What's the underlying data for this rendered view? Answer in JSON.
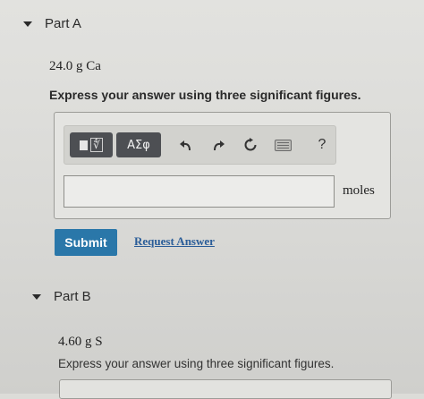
{
  "part_a": {
    "title": "Part A",
    "question": "24.0 g Ca",
    "instruction": "Express your answer using three significant figures.",
    "toolbar": {
      "greek_label": "ΑΣφ",
      "radical_glyph": "∜",
      "help_label": "?",
      "icons": [
        "templates-icon",
        "greek-symbols-icon",
        "undo-icon",
        "redo-icon",
        "reset-icon",
        "keyboard-icon",
        "help-icon"
      ]
    },
    "answer": {
      "value": "",
      "unit": "moles"
    },
    "submit_label": "Submit",
    "request_answer_label": "Request Answer"
  },
  "part_b": {
    "title": "Part B",
    "question": "4.60 g S",
    "instruction": "Express your answer using three significant figures."
  },
  "colors": {
    "submit_bg": "#2a77a9",
    "link": "#2a5d98",
    "toolbar_dark": "#4d4f53"
  }
}
